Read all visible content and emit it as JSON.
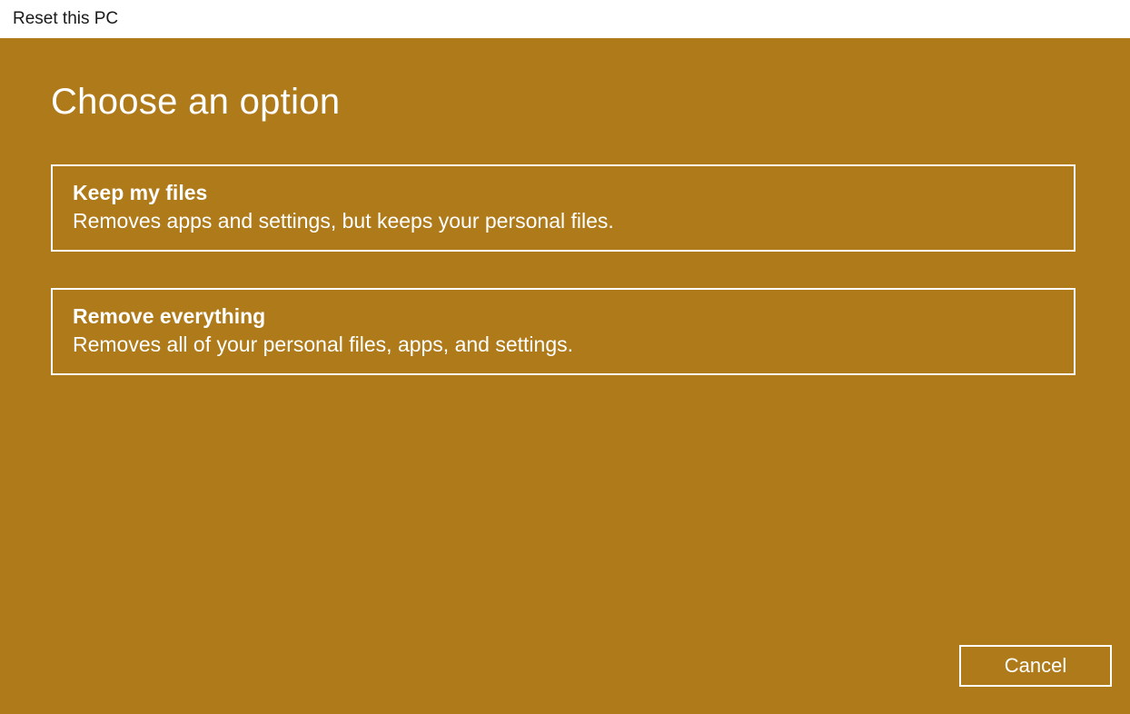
{
  "titlebar": {
    "title": "Reset this PC"
  },
  "page": {
    "heading": "Choose an option"
  },
  "options": [
    {
      "title": "Keep my files",
      "description": "Removes apps and settings, but keeps your personal files."
    },
    {
      "title": "Remove everything",
      "description": "Removes all of your personal files, apps, and settings."
    }
  ],
  "footer": {
    "cancel_label": "Cancel"
  }
}
